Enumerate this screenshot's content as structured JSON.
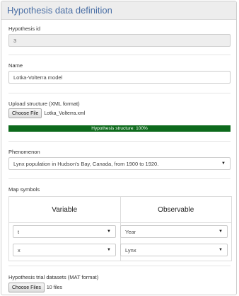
{
  "panel": {
    "title": "Hypothesis data definition"
  },
  "hypothesis_id": {
    "label": "Hypothesis id",
    "value": "3"
  },
  "name": {
    "label": "Name",
    "value": "Lotka-Volterra model"
  },
  "upload_structure": {
    "label": "Upload structure (XML format)",
    "button": "Choose File",
    "filename": "Lotka_Volterra.xml",
    "progress_text": "Hypothesis structure: 100%",
    "progress_percent": 100
  },
  "phenomenon": {
    "label": "Phenomenon",
    "selected": "Lynx population in Hudson's Bay, Canada, from 1900 to 1920."
  },
  "map_symbols": {
    "label": "Map symbols",
    "headers": {
      "variable": "Variable",
      "observable": "Observable"
    },
    "rows": [
      {
        "variable": "t",
        "observable": "Year"
      },
      {
        "variable": "x",
        "observable": "Lynx"
      }
    ]
  },
  "trial_datasets": {
    "label": "Hypothesis trial datasets (MAT format)",
    "button": "Choose Files",
    "file_count": "10 files"
  },
  "colors": {
    "title": "#4a6fa5",
    "progress": "#0d6a1c"
  }
}
